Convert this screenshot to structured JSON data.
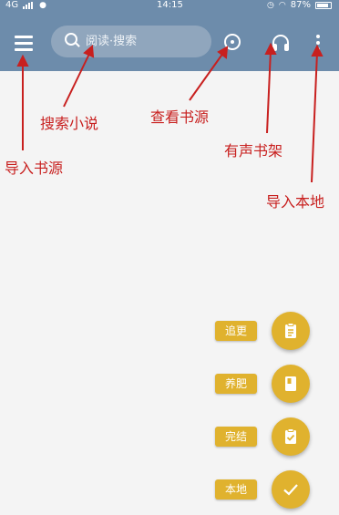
{
  "status_bar": {
    "network": "4G",
    "time": "14:15",
    "battery": "87%"
  },
  "toolbar": {
    "search_placeholder": "阅读·搜索"
  },
  "annotations": {
    "import_source": "导入书源",
    "search_novel": "搜索小说",
    "view_source": "查看书源",
    "audio_shelf": "有声书架",
    "import_local": "导入本地"
  },
  "fab_menu": [
    {
      "label": "追更",
      "icon": "clipboard-icon"
    },
    {
      "label": "养肥",
      "icon": "book-icon"
    },
    {
      "label": "完结",
      "icon": "clipboard-check-icon"
    },
    {
      "label": "本地",
      "icon": "check-icon"
    }
  ],
  "colors": {
    "toolbar": "#6d8cab",
    "accent": "#e0b22e",
    "annotation": "#c8201f",
    "background": "#f4f4f4"
  }
}
